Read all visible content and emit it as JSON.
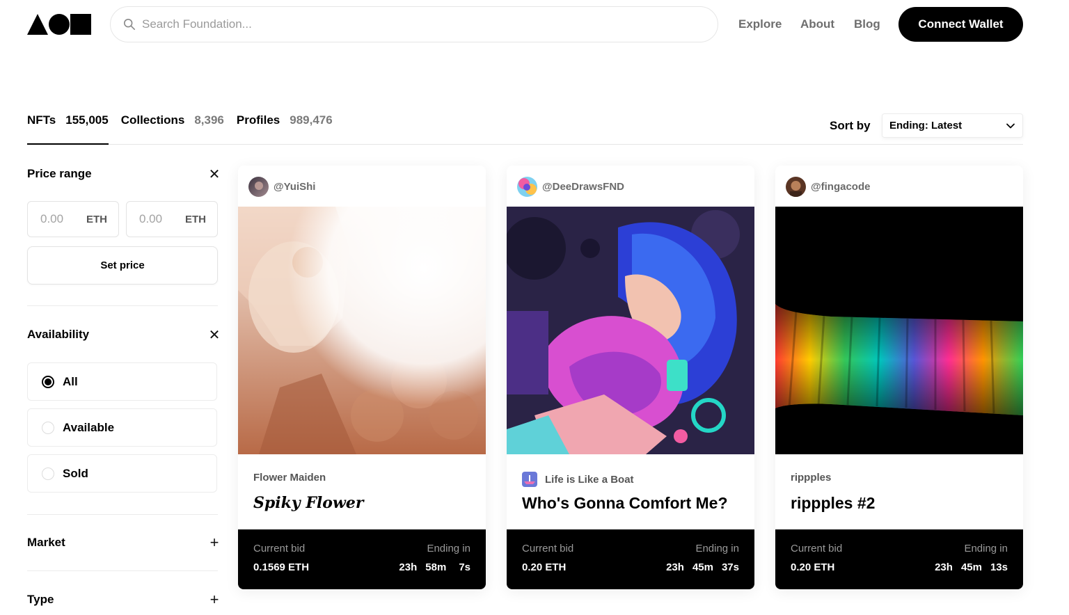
{
  "header": {
    "search_placeholder": "Search Foundation...",
    "nav": [
      "Explore",
      "About",
      "Blog"
    ],
    "connect_label": "Connect Wallet"
  },
  "tabs": [
    {
      "label": "NFTs",
      "count": "155,005"
    },
    {
      "label": "Collections",
      "count": "8,396"
    },
    {
      "label": "Profiles",
      "count": "989,476"
    }
  ],
  "sort": {
    "label": "Sort by",
    "value": "Ending: Latest"
  },
  "filters": {
    "price_range": {
      "title": "Price range",
      "min_placeholder": "0.00",
      "max_placeholder": "0.00",
      "unit": "ETH",
      "button": "Set price"
    },
    "availability": {
      "title": "Availability",
      "options": [
        "All",
        "Available",
        "Sold"
      ],
      "selected": "All"
    },
    "market": {
      "title": "Market"
    },
    "type": {
      "title": "Type"
    }
  },
  "cards": [
    {
      "creator": "@YuiShi",
      "collection": "Flower Maiden",
      "title": "Spiky Flower",
      "bid_label": "Current bid",
      "bid": "0.1569 ETH",
      "ending_label": "Ending in",
      "time": [
        "23h",
        "58m",
        "7s"
      ]
    },
    {
      "creator": "@DeeDrawsFND",
      "collection": "Life is Like a Boat",
      "title": "Who's Gonna Comfort Me?",
      "bid_label": "Current bid",
      "bid": "0.20 ETH",
      "ending_label": "Ending in",
      "time": [
        "23h",
        "45m",
        "37s"
      ]
    },
    {
      "creator": "@fingacode",
      "collection": "rippples",
      "title": "rippples #2",
      "bid_label": "Current bid",
      "bid": "0.20 ETH",
      "ending_label": "Ending in",
      "time": [
        "23h",
        "45m",
        "13s"
      ]
    }
  ]
}
